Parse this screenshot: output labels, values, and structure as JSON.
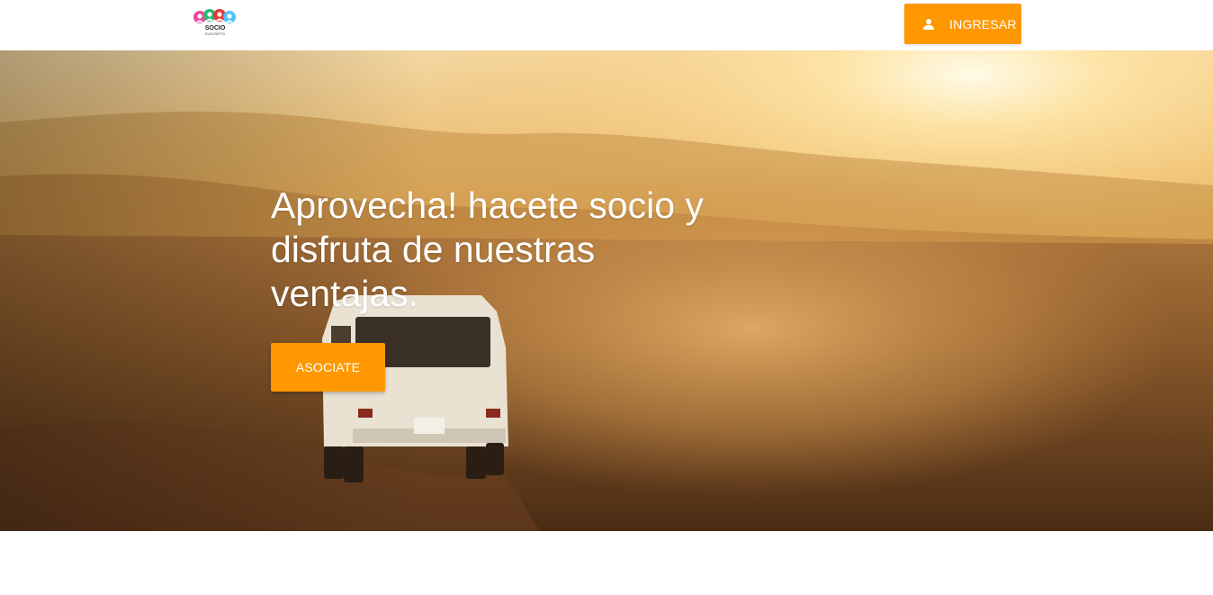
{
  "header": {
    "logo": {
      "text": "SOCIO",
      "subtext": "SUSCRIPTO",
      "colors": [
        "#e94b9b",
        "#2eb872",
        "#e53935",
        "#4fc3f7"
      ]
    },
    "login_button": {
      "label": "INGRESAR",
      "icon": "person-icon"
    }
  },
  "hero": {
    "title": "Aprovecha! hacete socio y disfruta de nuestras ventajas.",
    "cta_label": "ASOCIATE",
    "background": "desert-road-van-photo"
  },
  "colors": {
    "accent": "#ff9800",
    "header_bg": "#ffffff",
    "text_on_accent": "#ffffff"
  }
}
